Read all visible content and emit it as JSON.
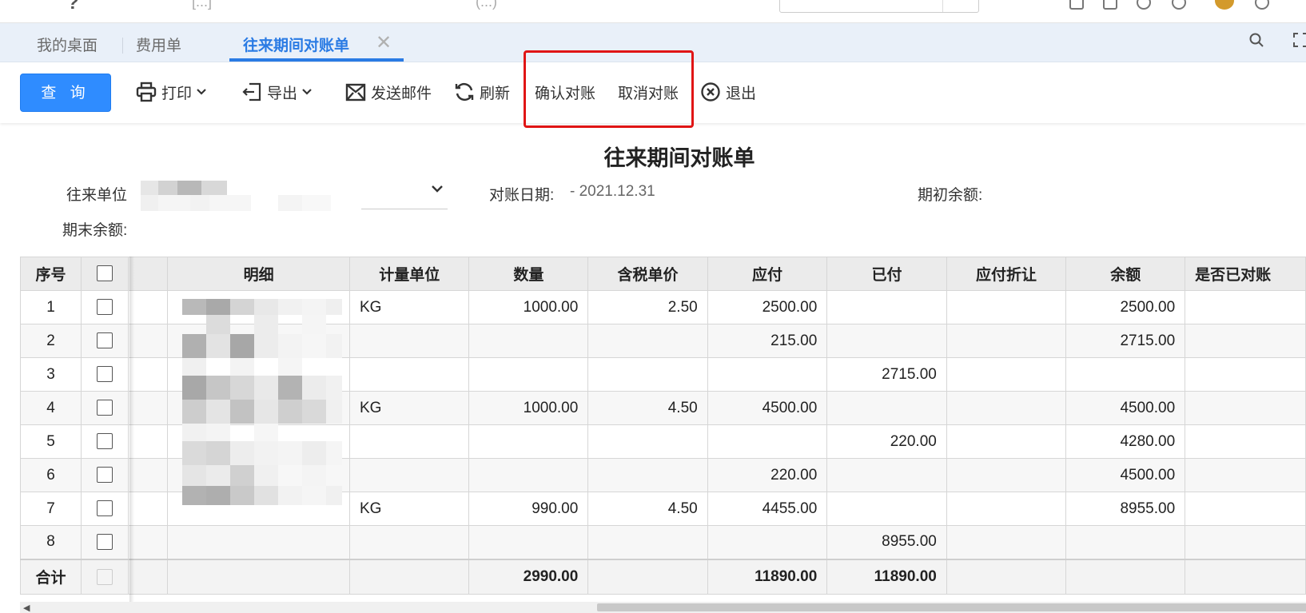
{
  "topbar": {
    "brand": "?",
    "company": "[...]",
    "date": "(...)"
  },
  "tabs": [
    {
      "label": "我的桌面"
    },
    {
      "label": "费用单"
    },
    {
      "label": "往来期间对账单"
    }
  ],
  "toolbar": {
    "query": "查 询",
    "print": "打印",
    "export": "导出",
    "send_mail": "发送邮件",
    "refresh": "刷新",
    "confirm": "确认对账",
    "cancel": "取消对账",
    "exit": "退出"
  },
  "report": {
    "title": "往来期间对账单",
    "partner_label": "往来单位",
    "recon_date_label": "对账日期:",
    "recon_date_value": "- 2021.12.31",
    "opening_label": "期初余额:",
    "closing_label": "期末余额:"
  },
  "grid": {
    "headers": [
      "序号",
      "",
      "",
      "明细",
      "计量单位",
      "数量",
      "含税单价",
      "应付",
      "已付",
      "应付折让",
      "余额",
      "是否已对账"
    ],
    "rows": [
      {
        "seq": "1",
        "unit": "KG",
        "qty": "1000.00",
        "price": "2.50",
        "payable": "2500.00",
        "paid": "",
        "discount": "",
        "balance": "2500.00"
      },
      {
        "seq": "2",
        "unit": "",
        "qty": "",
        "price": "",
        "payable": "215.00",
        "paid": "",
        "discount": "",
        "balance": "2715.00"
      },
      {
        "seq": "3",
        "unit": "",
        "qty": "",
        "price": "",
        "payable": "",
        "paid": "2715.00",
        "discount": "",
        "balance": ""
      },
      {
        "seq": "4",
        "unit": "KG",
        "qty": "1000.00",
        "price": "4.50",
        "payable": "4500.00",
        "paid": "",
        "discount": "",
        "balance": "4500.00"
      },
      {
        "seq": "5",
        "unit": "",
        "qty": "",
        "price": "",
        "payable": "",
        "paid": "220.00",
        "discount": "",
        "balance": "4280.00"
      },
      {
        "seq": "6",
        "unit": "",
        "qty": "",
        "price": "",
        "payable": "220.00",
        "paid": "",
        "discount": "",
        "balance": "4500.00"
      },
      {
        "seq": "7",
        "unit": "KG",
        "qty": "990.00",
        "price": "4.50",
        "payable": "4455.00",
        "paid": "",
        "discount": "",
        "balance": "8955.00"
      },
      {
        "seq": "8",
        "unit": "",
        "qty": "",
        "price": "",
        "payable": "",
        "paid": "8955.00",
        "discount": "",
        "balance": ""
      }
    ],
    "total": {
      "label": "合计",
      "qty": "2990.00",
      "payable": "11890.00",
      "paid": "11890.00"
    }
  },
  "colors": {
    "accent": "#2a7be4",
    "primary_button": "#2f8cff",
    "highlight_box": "#e01515"
  }
}
